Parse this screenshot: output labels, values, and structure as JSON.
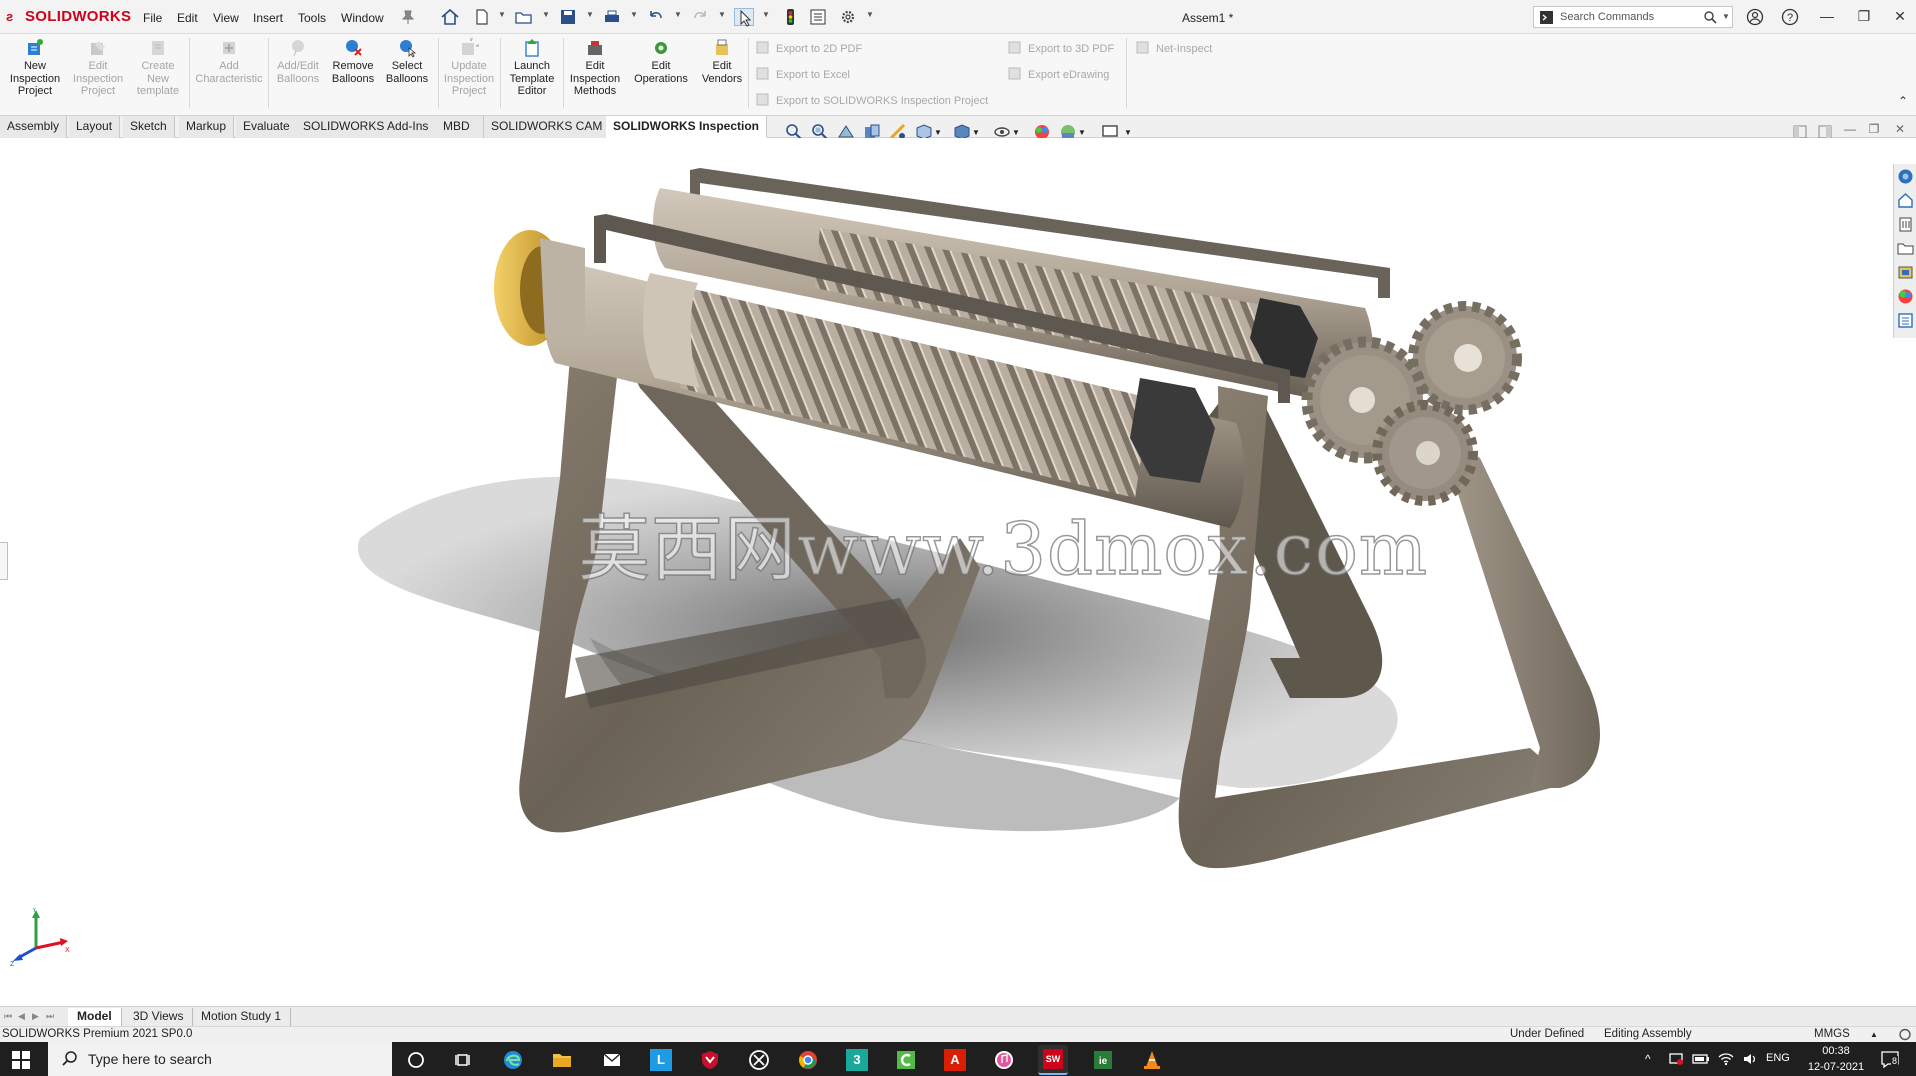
{
  "app": {
    "logo": "SOLIDWORKS",
    "document_title": "Assem1 *",
    "menu": [
      "File",
      "Edit",
      "View",
      "Insert",
      "Tools",
      "Window"
    ],
    "search_placeholder": "Search Commands"
  },
  "ribbon": {
    "buttons": [
      {
        "label": "New\nInspection\nProject",
        "enabled": true
      },
      {
        "label": "Edit\nInspection\nProject",
        "enabled": false
      },
      {
        "label": "Create\nNew\ntemplate",
        "enabled": false
      },
      {
        "label": "Add\nCharacteristic",
        "enabled": false
      },
      {
        "label": "Add/Edit\nBalloons",
        "enabled": false
      },
      {
        "label": "Remove\nBalloons",
        "enabled": true
      },
      {
        "label": "Select\nBalloons",
        "enabled": true
      },
      {
        "label": "Update\nInspection\nProject",
        "enabled": false
      },
      {
        "label": "Launch\nTemplate\nEditor",
        "enabled": true
      },
      {
        "label": "Edit\nInspection\nMethods",
        "enabled": true
      },
      {
        "label": "Edit\nOperations",
        "enabled": true
      },
      {
        "label": "Edit\nVendors",
        "enabled": true
      }
    ],
    "export_2d_pdf": "Export to 2D PDF",
    "export_excel": "Export to Excel",
    "export_inspection_project": "Export to SOLIDWORKS Inspection Project",
    "export_3d_pdf": "Export to 3D PDF",
    "export_edrawing": "Export eDrawing",
    "net_inspect": "Net-Inspect"
  },
  "tabs": [
    {
      "label": "Assembly",
      "active": false
    },
    {
      "label": "Layout",
      "active": false
    },
    {
      "label": "Sketch",
      "active": false
    },
    {
      "label": "Markup",
      "active": false
    },
    {
      "label": "Evaluate",
      "active": false
    },
    {
      "label": "SOLIDWORKS Add-Ins",
      "active": false
    },
    {
      "label": "MBD",
      "active": false
    },
    {
      "label": "SOLIDWORKS CAM",
      "active": false
    },
    {
      "label": "SOLIDWORKS Inspection",
      "active": true
    }
  ],
  "viewport": {
    "watermark": "莫西网www.3dmox.com"
  },
  "bottom_tabs": [
    {
      "label": "Model",
      "active": true
    },
    {
      "label": "3D Views",
      "active": false
    },
    {
      "label": "Motion Study 1",
      "active": false
    }
  ],
  "status": {
    "version": "SOLIDWORKS Premium 2021 SP0.0",
    "definition": "Under Defined",
    "mode": "Editing Assembly",
    "units": "MMGS"
  },
  "taskbar": {
    "search_placeholder": "Type here to search",
    "language": "ENG",
    "time": "00:38",
    "date": "12-07-2021",
    "notifications": "8"
  },
  "colors": {
    "brand_red": "#d0021b",
    "taskbar": "#1f1f1f"
  }
}
